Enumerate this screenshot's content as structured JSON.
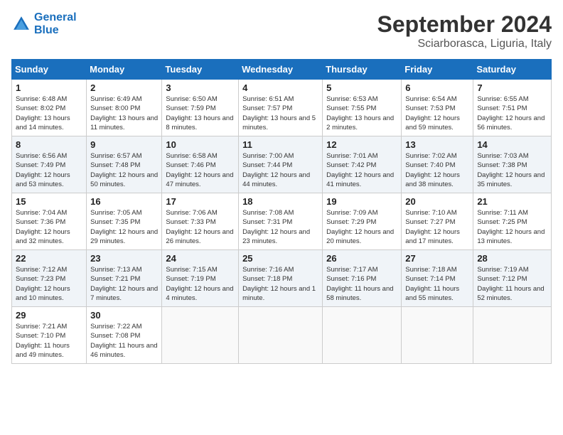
{
  "header": {
    "logo_line1": "General",
    "logo_line2": "Blue",
    "month": "September 2024",
    "location": "Sciarborasca, Liguria, Italy"
  },
  "weekdays": [
    "Sunday",
    "Monday",
    "Tuesday",
    "Wednesday",
    "Thursday",
    "Friday",
    "Saturday"
  ],
  "weeks": [
    [
      {
        "day": "1",
        "info": "Sunrise: 6:48 AM\nSunset: 8:02 PM\nDaylight: 13 hours and 14 minutes."
      },
      {
        "day": "2",
        "info": "Sunrise: 6:49 AM\nSunset: 8:00 PM\nDaylight: 13 hours and 11 minutes."
      },
      {
        "day": "3",
        "info": "Sunrise: 6:50 AM\nSunset: 7:59 PM\nDaylight: 13 hours and 8 minutes."
      },
      {
        "day": "4",
        "info": "Sunrise: 6:51 AM\nSunset: 7:57 PM\nDaylight: 13 hours and 5 minutes."
      },
      {
        "day": "5",
        "info": "Sunrise: 6:53 AM\nSunset: 7:55 PM\nDaylight: 13 hours and 2 minutes."
      },
      {
        "day": "6",
        "info": "Sunrise: 6:54 AM\nSunset: 7:53 PM\nDaylight: 12 hours and 59 minutes."
      },
      {
        "day": "7",
        "info": "Sunrise: 6:55 AM\nSunset: 7:51 PM\nDaylight: 12 hours and 56 minutes."
      }
    ],
    [
      {
        "day": "8",
        "info": "Sunrise: 6:56 AM\nSunset: 7:49 PM\nDaylight: 12 hours and 53 minutes."
      },
      {
        "day": "9",
        "info": "Sunrise: 6:57 AM\nSunset: 7:48 PM\nDaylight: 12 hours and 50 minutes."
      },
      {
        "day": "10",
        "info": "Sunrise: 6:58 AM\nSunset: 7:46 PM\nDaylight: 12 hours and 47 minutes."
      },
      {
        "day": "11",
        "info": "Sunrise: 7:00 AM\nSunset: 7:44 PM\nDaylight: 12 hours and 44 minutes."
      },
      {
        "day": "12",
        "info": "Sunrise: 7:01 AM\nSunset: 7:42 PM\nDaylight: 12 hours and 41 minutes."
      },
      {
        "day": "13",
        "info": "Sunrise: 7:02 AM\nSunset: 7:40 PM\nDaylight: 12 hours and 38 minutes."
      },
      {
        "day": "14",
        "info": "Sunrise: 7:03 AM\nSunset: 7:38 PM\nDaylight: 12 hours and 35 minutes."
      }
    ],
    [
      {
        "day": "15",
        "info": "Sunrise: 7:04 AM\nSunset: 7:36 PM\nDaylight: 12 hours and 32 minutes."
      },
      {
        "day": "16",
        "info": "Sunrise: 7:05 AM\nSunset: 7:35 PM\nDaylight: 12 hours and 29 minutes."
      },
      {
        "day": "17",
        "info": "Sunrise: 7:06 AM\nSunset: 7:33 PM\nDaylight: 12 hours and 26 minutes."
      },
      {
        "day": "18",
        "info": "Sunrise: 7:08 AM\nSunset: 7:31 PM\nDaylight: 12 hours and 23 minutes."
      },
      {
        "day": "19",
        "info": "Sunrise: 7:09 AM\nSunset: 7:29 PM\nDaylight: 12 hours and 20 minutes."
      },
      {
        "day": "20",
        "info": "Sunrise: 7:10 AM\nSunset: 7:27 PM\nDaylight: 12 hours and 17 minutes."
      },
      {
        "day": "21",
        "info": "Sunrise: 7:11 AM\nSunset: 7:25 PM\nDaylight: 12 hours and 13 minutes."
      }
    ],
    [
      {
        "day": "22",
        "info": "Sunrise: 7:12 AM\nSunset: 7:23 PM\nDaylight: 12 hours and 10 minutes."
      },
      {
        "day": "23",
        "info": "Sunrise: 7:13 AM\nSunset: 7:21 PM\nDaylight: 12 hours and 7 minutes."
      },
      {
        "day": "24",
        "info": "Sunrise: 7:15 AM\nSunset: 7:19 PM\nDaylight: 12 hours and 4 minutes."
      },
      {
        "day": "25",
        "info": "Sunrise: 7:16 AM\nSunset: 7:18 PM\nDaylight: 12 hours and 1 minute."
      },
      {
        "day": "26",
        "info": "Sunrise: 7:17 AM\nSunset: 7:16 PM\nDaylight: 11 hours and 58 minutes."
      },
      {
        "day": "27",
        "info": "Sunrise: 7:18 AM\nSunset: 7:14 PM\nDaylight: 11 hours and 55 minutes."
      },
      {
        "day": "28",
        "info": "Sunrise: 7:19 AM\nSunset: 7:12 PM\nDaylight: 11 hours and 52 minutes."
      }
    ],
    [
      {
        "day": "29",
        "info": "Sunrise: 7:21 AM\nSunset: 7:10 PM\nDaylight: 11 hours and 49 minutes."
      },
      {
        "day": "30",
        "info": "Sunrise: 7:22 AM\nSunset: 7:08 PM\nDaylight: 11 hours and 46 minutes."
      },
      {
        "day": "",
        "info": ""
      },
      {
        "day": "",
        "info": ""
      },
      {
        "day": "",
        "info": ""
      },
      {
        "day": "",
        "info": ""
      },
      {
        "day": "",
        "info": ""
      }
    ]
  ]
}
